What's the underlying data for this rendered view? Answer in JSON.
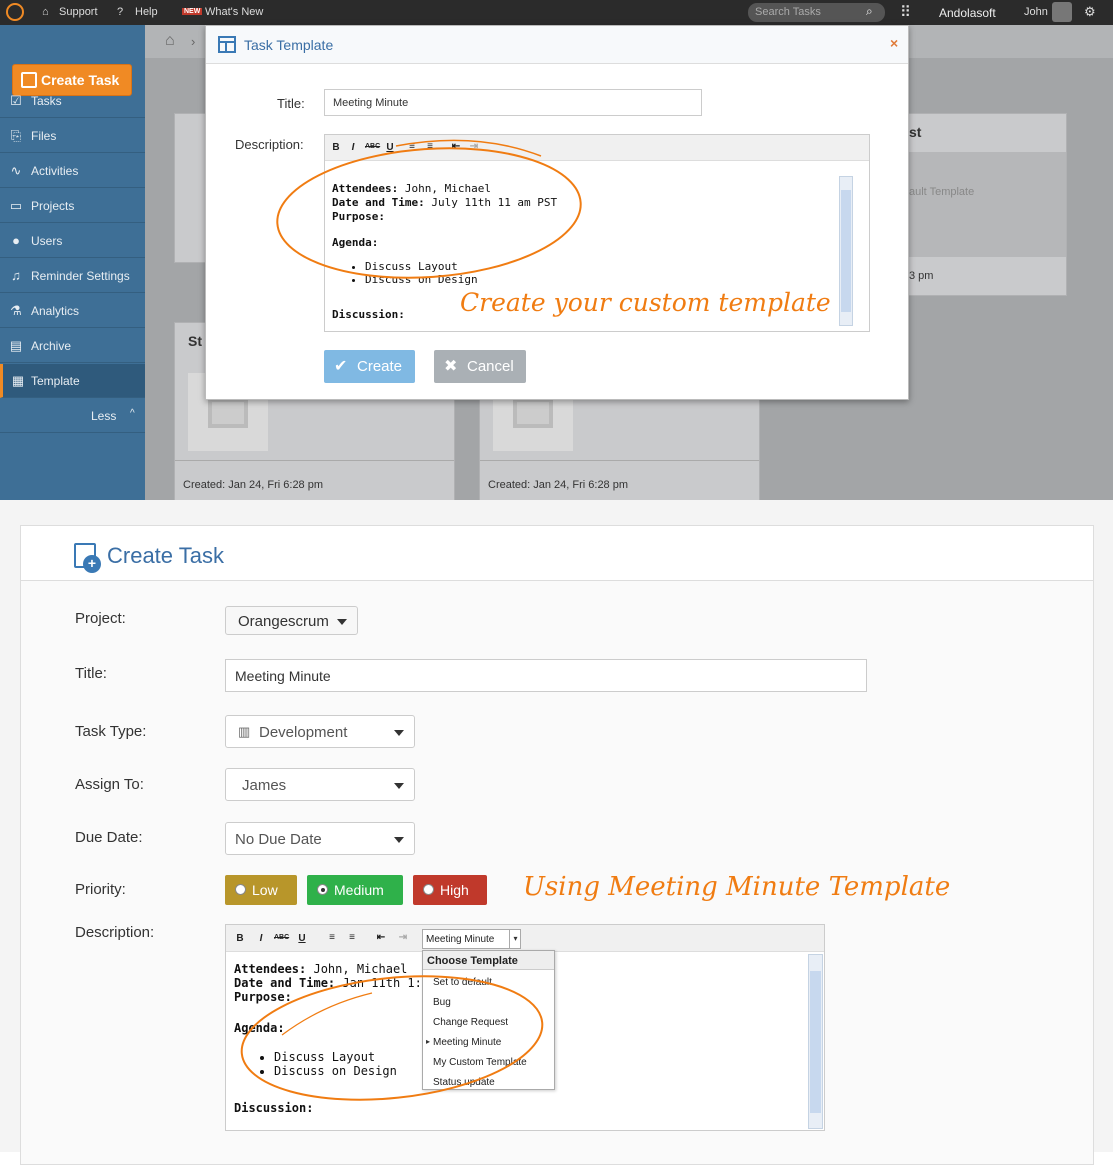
{
  "topbar": {
    "support": "Support",
    "help": "Help",
    "new_badge": "NEW",
    "whats_new": "What's New",
    "search_placeholder": "Search Tasks",
    "company": "Andolasoft",
    "user": "John"
  },
  "sidebar": {
    "create_task": "Create Task",
    "items": [
      {
        "label": "Tasks",
        "icon": "tasks-icon"
      },
      {
        "label": "Files",
        "icon": "paperclip-icon"
      },
      {
        "label": "Activities",
        "icon": "activity-icon"
      },
      {
        "label": "Projects",
        "icon": "folder-icon"
      },
      {
        "label": "Users",
        "icon": "user-icon"
      },
      {
        "label": "Reminder Settings",
        "icon": "bell-icon"
      },
      {
        "label": "Analytics",
        "icon": "analytics-icon"
      },
      {
        "label": "Archive",
        "icon": "archive-icon"
      },
      {
        "label": "Template",
        "icon": "template-icon"
      }
    ],
    "less": "Less"
  },
  "background_cards": {
    "card1_partial_title": "st",
    "card1_partial_desc": "ault Template",
    "card1_partial_time": "3 pm",
    "card2_partial_title": "St",
    "created_left": "Created: Jan 24, Fri 6:28 pm",
    "created_right": "Created: Jan 24, Fri 6:28 pm"
  },
  "modal": {
    "title": "Task Template",
    "title_label": "Title:",
    "title_value": "Meeting Minute",
    "description_label": "Description:",
    "editor": {
      "attendees_label": "Attendees:",
      "attendees_value": " John, Michael",
      "datetime_label": "Date and Time:",
      "datetime_value": " July 11th 11 am PST",
      "purpose_label": "Purpose:",
      "agenda_label": "Agenda:",
      "agenda_items": [
        "Discuss Layout",
        "Discuss on Design"
      ],
      "discussion_label": "Discussion:"
    },
    "create_button": "Create",
    "cancel_button": "Cancel",
    "annotation": "Create your custom template"
  },
  "create_task_form": {
    "heading": "Create Task",
    "project_label": "Project:",
    "project_value": "Orangescrum",
    "title_label": "Title:",
    "title_value": "Meeting Minute",
    "task_type_label": "Task Type:",
    "task_type_value": "Development",
    "assign_label": "Assign To:",
    "assign_value": "James",
    "due_label": "Due Date:",
    "due_value": "No Due Date",
    "priority_label": "Priority:",
    "priority_low": "Low",
    "priority_medium": "Medium",
    "priority_high": "High",
    "annotation": "Using Meeting Minute Template",
    "description_label": "Description:",
    "template_select_value": "Meeting Minute",
    "template_menu": {
      "header": "Choose Template",
      "items": [
        "Set to default",
        "Bug",
        "Change Request",
        "Meeting Minute",
        "My Custom Template",
        "Status update"
      ]
    },
    "editor": {
      "attendees_label": "Attendees:",
      "attendees_value": " John, Michael",
      "datetime_label": "Date and Time:",
      "datetime_value": " Jan 11th 1:",
      "purpose_label": "Purpose:",
      "agenda_label": "Agenda:",
      "agenda_items": [
        "Discuss Layout",
        "Discuss on Design"
      ],
      "discussion_label": "Discussion:"
    }
  },
  "colors": {
    "orange": "#f08a24",
    "sidebar": "#3e6f96",
    "low": "#b8962a",
    "medium": "#2fb14a",
    "high": "#c0392b"
  }
}
